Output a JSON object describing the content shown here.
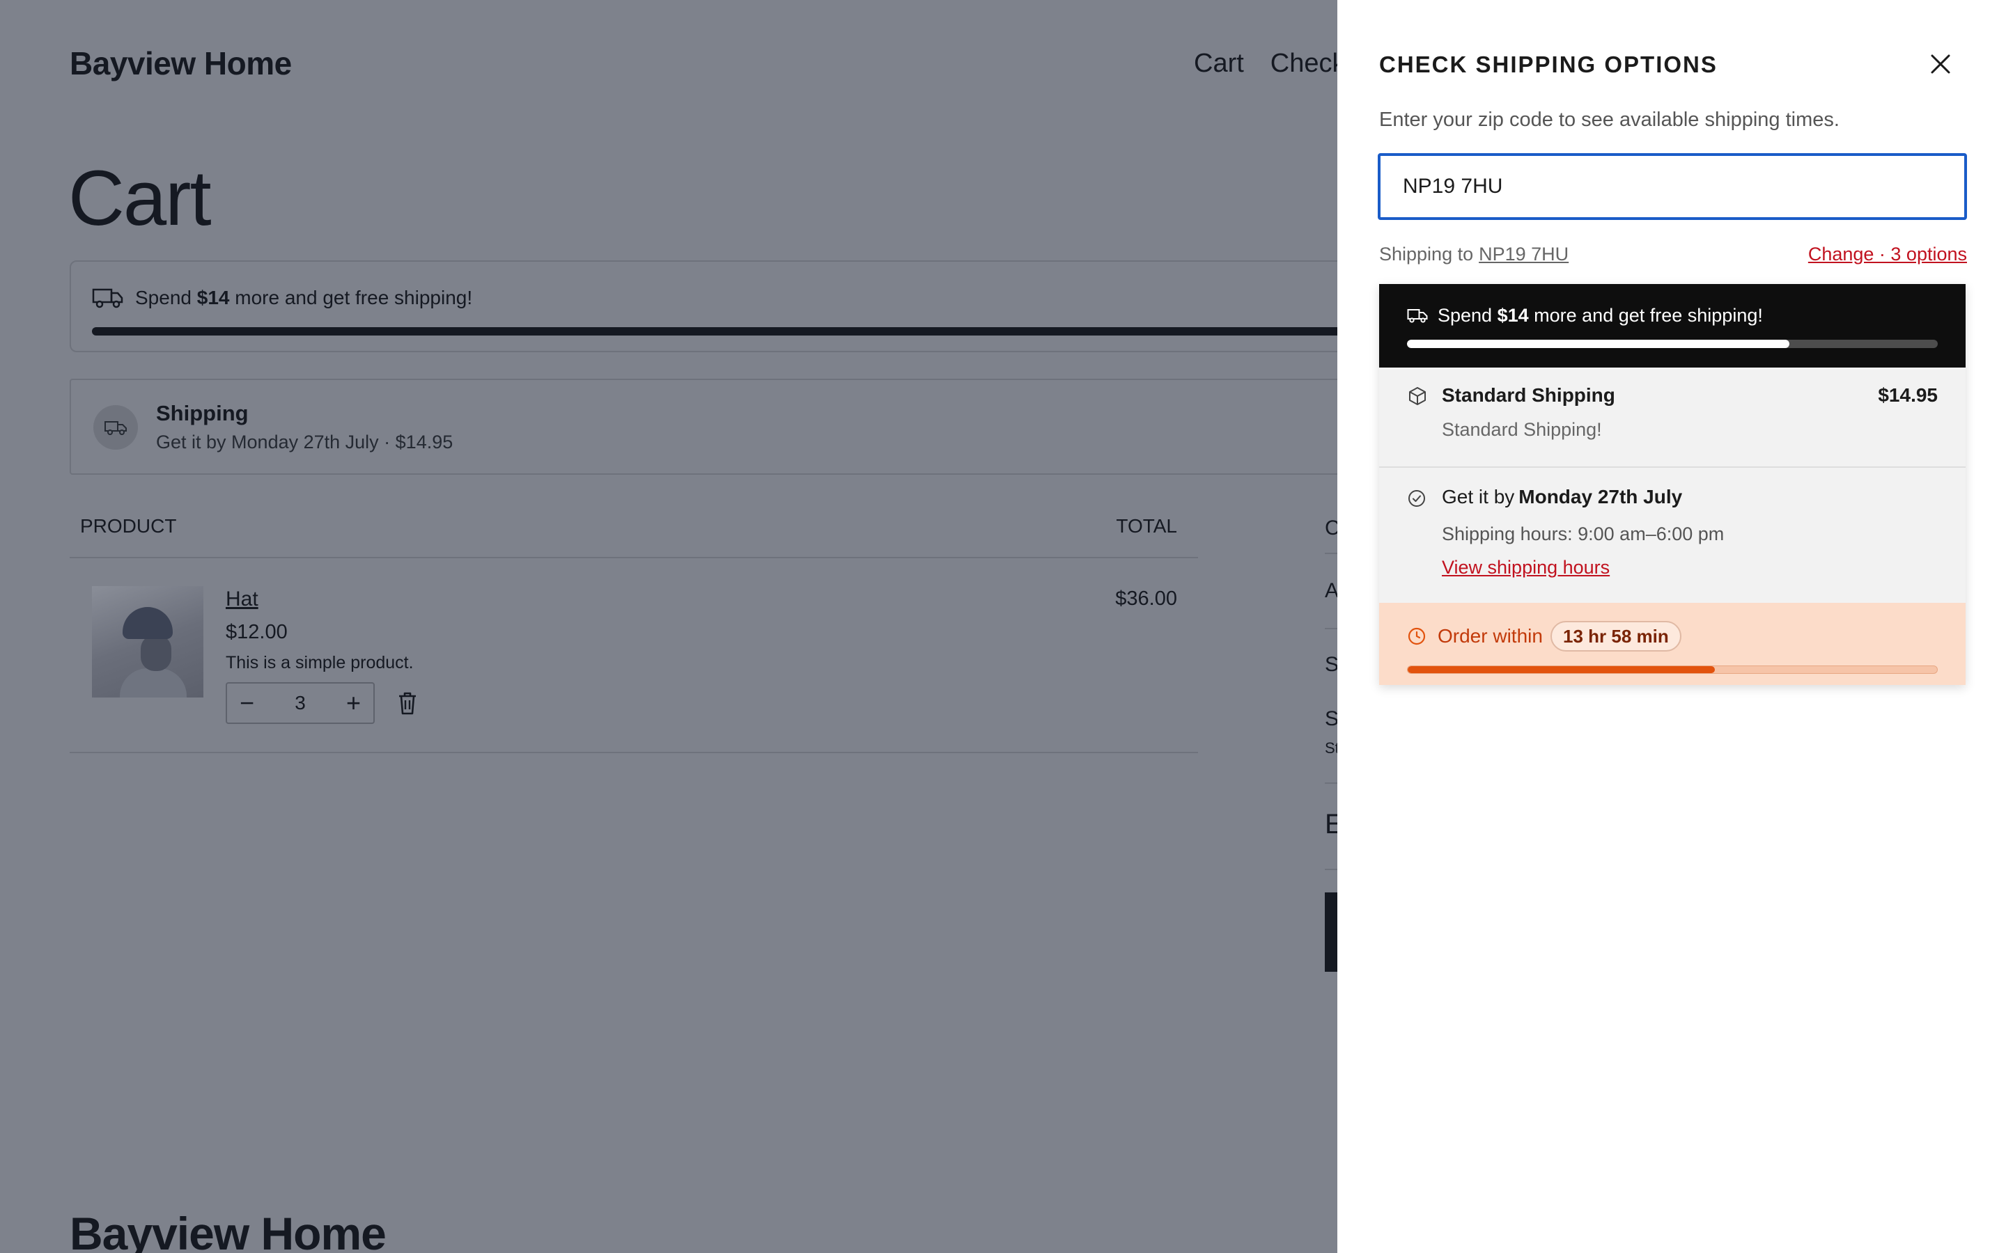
{
  "store": {
    "logo": "Bayview Home",
    "nav": [
      "Cart",
      "Check"
    ],
    "footer_logo": "Bayview Home"
  },
  "cart": {
    "title": "Cart",
    "free_shipping": {
      "prefix": "Spend ",
      "amount": "$14",
      "suffix": " more and get free shipping!"
    },
    "shipping_card": {
      "title": "Shipping",
      "subtitle": "Get it by Monday 27th July · $14.95"
    },
    "table": {
      "col_product": "PRODUCT",
      "col_total": "TOTAL"
    },
    "item": {
      "name": "Hat",
      "price": "$12.00",
      "description": "This is a simple product.",
      "quantity": "3",
      "total": "$36.00"
    },
    "summary_partial": [
      "C",
      "A",
      "S",
      "S",
      "St",
      "E"
    ]
  },
  "drawer": {
    "title": "CHECK SHIPPING OPTIONS",
    "description": "Enter your zip code to see available shipping times.",
    "zip_value": "NP19 7HU",
    "shipping_to_label": "Shipping to",
    "shipping_to_code": "NP19 7HU",
    "change_link": "Change · 3 options",
    "free_shipping": {
      "prefix": "Spend ",
      "amount": "$14",
      "suffix": " more and get free shipping!",
      "progress": 0.72
    },
    "standard": {
      "name": "Standard Shipping",
      "price": "$14.95",
      "description": "Standard Shipping!"
    },
    "delivery": {
      "prefix": "Get it by",
      "date": "Monday 27th July",
      "hours": "Shipping hours: 9:00 am–6:00 pm",
      "hours_link": "View shipping hours"
    },
    "cutoff": {
      "label": "Order within",
      "time": "13 hr 58 min",
      "progress": 0.58
    }
  },
  "icons": [
    "truck-icon",
    "box-icon",
    "check-circle-icon",
    "clock-icon",
    "close-icon",
    "trash-icon",
    "minus-icon",
    "plus-icon"
  ],
  "colors": {
    "accent_blue": "#1a5cc8",
    "link_red": "#c1121f",
    "orange": "#e2530e",
    "overlay": "#7e828c"
  }
}
